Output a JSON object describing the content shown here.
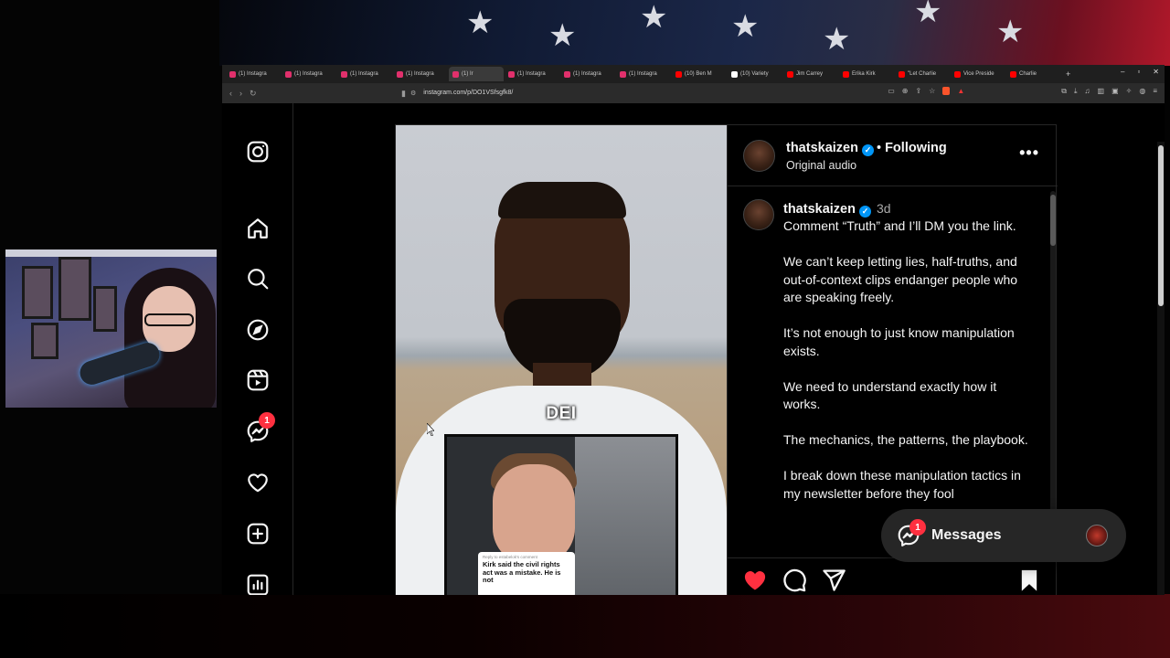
{
  "browser": {
    "tabs": [
      {
        "label": "(1) Instagra",
        "favicon_color": "#e1306c",
        "active": false
      },
      {
        "label": "(1) Instagra",
        "favicon_color": "#e1306c",
        "active": false
      },
      {
        "label": "(1) Instagra",
        "favicon_color": "#e1306c",
        "active": false
      },
      {
        "label": "(1) Instagra",
        "favicon_color": "#e1306c",
        "active": false
      },
      {
        "label": "(1) Ir",
        "favicon_color": "#e1306c",
        "active": true
      },
      {
        "label": "(1) Instagra",
        "favicon_color": "#e1306c",
        "active": false
      },
      {
        "label": "(1) Instagra",
        "favicon_color": "#e1306c",
        "active": false
      },
      {
        "label": "(1) Instagra",
        "favicon_color": "#e1306c",
        "active": false
      },
      {
        "label": "(10) Ben M",
        "favicon_color": "#ff0000",
        "active": false
      },
      {
        "label": "(10) Variety",
        "favicon_color": "#ffffff",
        "active": false
      },
      {
        "label": "Jim Carrey",
        "favicon_color": "#ff0000",
        "active": false
      },
      {
        "label": "Erika Kirk",
        "favicon_color": "#ff0000",
        "active": false
      },
      {
        "label": "\"Let Charlie",
        "favicon_color": "#ff0000",
        "active": false
      },
      {
        "label": "Vice Preside",
        "favicon_color": "#ff0000",
        "active": false
      },
      {
        "label": "Charlie",
        "favicon_color": "#ff0000",
        "active": false
      }
    ],
    "new_tab": "+",
    "url": "instagram.com/p/DO1VSfsgfk8/"
  },
  "nav": {
    "messages_badge": "1"
  },
  "post": {
    "header": {
      "username": "thatskaizen",
      "separator": "•",
      "follow_state": "Following",
      "audio": "Original audio",
      "more": "•••"
    },
    "video": {
      "caption_overlay": "DEI",
      "reply_title": "Reply to estabelok's comment",
      "reply_text": "Kirk said the civil rights act was a mistake. He is not"
    },
    "comment": {
      "username": "thatskaizen",
      "time": "3d",
      "paragraphs": [
        "Comment “Truth” and I’ll DM you the link.",
        "We can’t keep letting lies, half-truths, and out-of-context clips endanger people who are speaking freely.",
        "It’s not enough to just know manipulation exists.",
        "We need to understand exactly how it works.",
        "The mechanics, the patterns, the playbook.",
        "I break down these manipulation tactics in my newsletter before they fool"
      ]
    }
  },
  "messages": {
    "label": "Messages",
    "badge": "1"
  },
  "colors": {
    "ig_background": "#000000",
    "liked_heart": "#ff3040",
    "verified": "#0095f6",
    "badge": "#ff3040"
  }
}
